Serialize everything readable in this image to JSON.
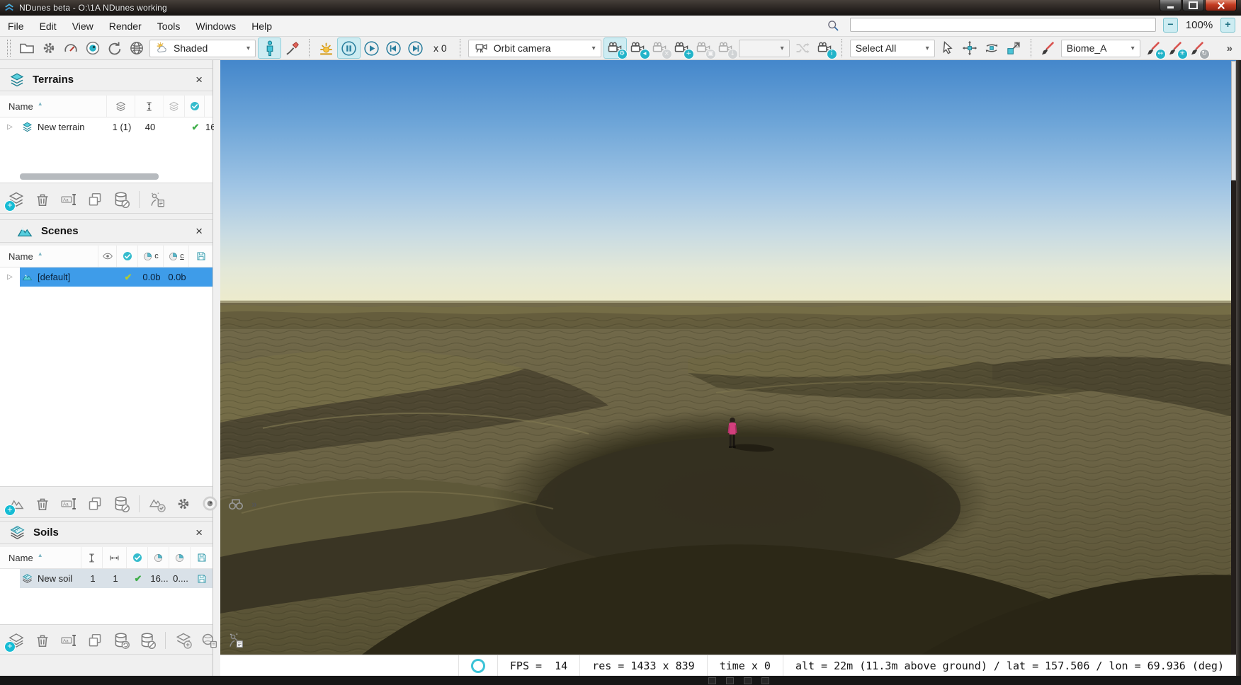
{
  "icons": {
    "close": "×",
    "overflow": "»",
    "expand": "▷",
    "check": "✔",
    "sort": "▲",
    "caret": "▾"
  },
  "badges": {
    "gear": "⚙",
    "back": "◂",
    "x": "×",
    "plus": "+",
    "save": "▣",
    "down": "↓",
    "info": "i",
    "move": "↔",
    "scatter": "✳",
    "rotate": "↻",
    "add": "+"
  },
  "window": {
    "title": "NDunes beta - O:\\1A NDunes working"
  },
  "menu": {
    "items": [
      "File",
      "Edit",
      "View",
      "Render",
      "Tools",
      "Windows",
      "Help"
    ]
  },
  "zoom": {
    "out": "−",
    "level": "100%",
    "in": "+"
  },
  "toolbar": {
    "shading": "Shaded",
    "speed": "x 0",
    "camera": "Orbit camera",
    "selection": "Select All",
    "biome": "Biome_A"
  },
  "terrains": {
    "title": "Terrains",
    "name_col": "Name",
    "row": {
      "name": "New terrain",
      "layers": "1 (1)",
      "height": "40",
      "clipped": "16"
    }
  },
  "scenes": {
    "title": "Scenes",
    "name_col": "Name",
    "pie1": "c",
    "pie2": "c",
    "row": {
      "name": "[default]",
      "size1": "0.0b",
      "size2": "0.0b"
    }
  },
  "soils": {
    "title": "Soils",
    "name_col": "Name",
    "row": {
      "name": "New soil",
      "height": "1",
      "width": "1",
      "v1": "16...",
      "v2": "0...."
    }
  },
  "status": {
    "fps": "FPS =  14",
    "res": "res = 1433 x 839",
    "time": "time x 0",
    "geo": "alt = 22m (11.3m above ground) / lat = 157.506 / lon = 69.936 (deg)"
  }
}
